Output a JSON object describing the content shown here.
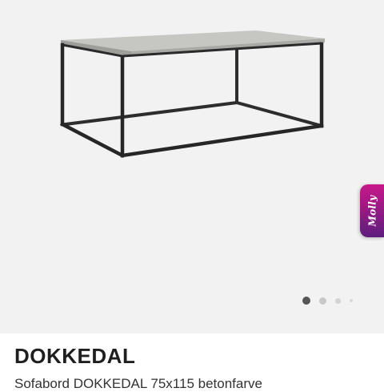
{
  "gallery": {
    "image_description": "Rectangular coffee table with concrete-colored top and black metal frame",
    "molly_tab_label": "Molly",
    "pagination": {
      "total": 4,
      "active": 1
    }
  },
  "product": {
    "title": "DOKKEDAL",
    "subtitle": "Sofabord DOKKEDAL 75x115 betonfarve"
  },
  "colors": {
    "gallery_bg": "#f2f2f2",
    "molly_gradient_top": "#c8188a",
    "molly_gradient_bottom": "#5e1d7e",
    "table_top": "#b9b9b6",
    "frame": "#2b2b2b"
  }
}
